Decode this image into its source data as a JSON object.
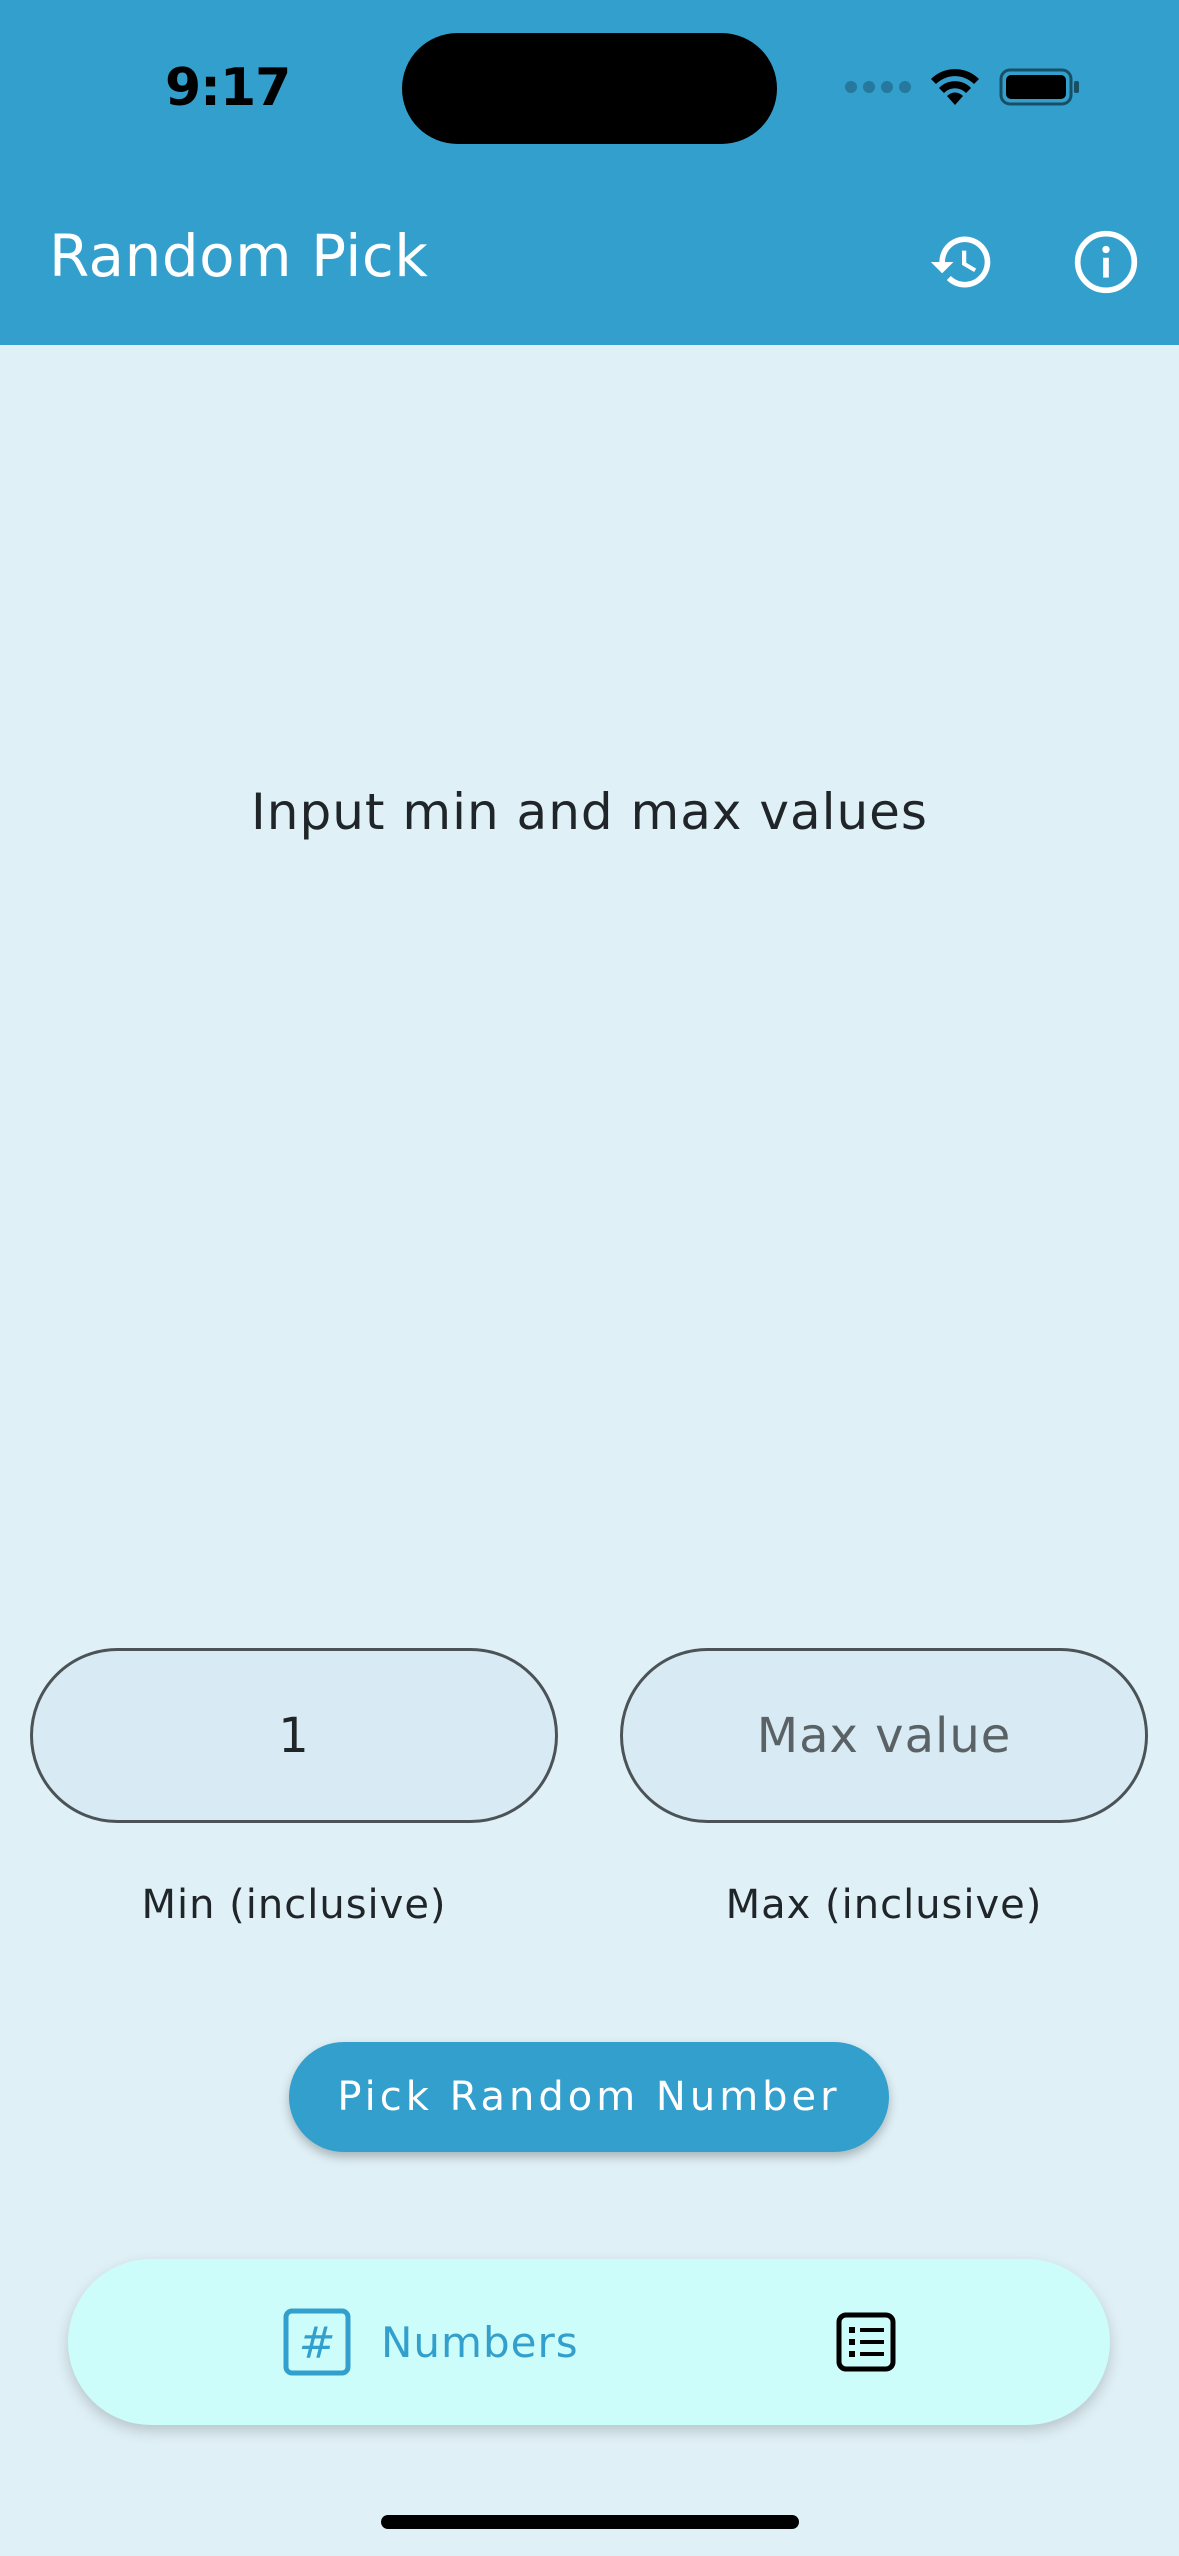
{
  "status_bar": {
    "time": "9:17"
  },
  "app_bar": {
    "title": "Random Pick",
    "history_icon": "history-icon",
    "info_icon": "info-icon",
    "background": "#339fcc"
  },
  "main": {
    "prompt": "Input min and max values"
  },
  "inputs": {
    "min_value": "1",
    "max_placeholder": "Max value",
    "min_helper": "Min (inclusive)",
    "max_helper": "Max (inclusive)"
  },
  "actions": {
    "pick_label": "Pick Random Number"
  },
  "bottom_nav": {
    "items": [
      {
        "label": "Numbers",
        "icon": "hash-icon",
        "selected": true
      },
      {
        "label": "",
        "icon": "list-icon",
        "selected": false
      }
    ],
    "background": "#ccfdfb",
    "accent": "#339fcc"
  }
}
